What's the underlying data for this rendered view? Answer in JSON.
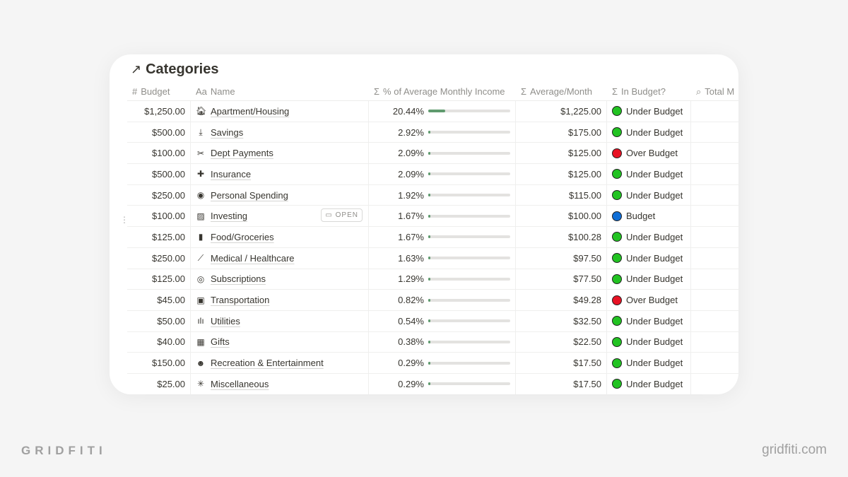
{
  "title": "Categories",
  "columns": [
    {
      "icon": "hash-icon",
      "glyph": "#",
      "label": "Budget"
    },
    {
      "icon": "text-icon",
      "glyph": "Aa",
      "label": "Name"
    },
    {
      "icon": "sigma-icon",
      "glyph": "Σ",
      "label": "% of Average Monthly Income"
    },
    {
      "icon": "sigma-icon",
      "glyph": "Σ",
      "label": "Average/Month"
    },
    {
      "icon": "sigma-icon",
      "glyph": "Σ",
      "label": "In Budget?"
    },
    {
      "icon": "search-icon",
      "glyph": "⌕",
      "label": "Total M"
    }
  ],
  "open_label": "OPEN",
  "status_colors": {
    "Under Budget": "#22c322",
    "Over Budget": "#e81224",
    "Budget": "#0f6ed6"
  },
  "rows": [
    {
      "budget": "$1,250.00",
      "icon": "house-icon",
      "glyph": "🏠︎",
      "name": "Apartment/Housing",
      "pct": "20.44%",
      "pct_value": 20.44,
      "avg": "$1,225.00",
      "status": "Under Budget"
    },
    {
      "budget": "$500.00",
      "icon": "download-icon",
      "glyph": "⤓",
      "name": "Savings",
      "pct": "2.92%",
      "pct_value": 2.92,
      "avg": "$175.00",
      "status": "Under Budget"
    },
    {
      "budget": "$100.00",
      "icon": "debt-icon",
      "glyph": "✂",
      "name": "Dept Payments",
      "pct": "2.09%",
      "pct_value": 2.09,
      "avg": "$125.00",
      "status": "Over Budget"
    },
    {
      "budget": "$500.00",
      "icon": "cross-icon",
      "glyph": "✚",
      "name": "Insurance",
      "pct": "2.09%",
      "pct_value": 2.09,
      "avg": "$125.00",
      "status": "Under Budget"
    },
    {
      "budget": "$250.00",
      "icon": "user-circle-icon",
      "glyph": "◉",
      "name": "Personal Spending",
      "pct": "1.92%",
      "pct_value": 1.92,
      "avg": "$115.00",
      "status": "Under Budget"
    },
    {
      "budget": "$100.00",
      "icon": "chart-icon",
      "glyph": "▨",
      "name": "Investing",
      "pct": "1.67%",
      "pct_value": 1.67,
      "avg": "$100.00",
      "status": "Budget",
      "open": true
    },
    {
      "budget": "$125.00",
      "icon": "bread-icon",
      "glyph": "▮",
      "name": "Food/Groceries",
      "pct": "1.67%",
      "pct_value": 1.67,
      "avg": "$100.28",
      "status": "Under Budget"
    },
    {
      "budget": "$250.00",
      "icon": "syringe-icon",
      "glyph": "⟋",
      "name": "Medical / Healthcare",
      "pct": "1.63%",
      "pct_value": 1.63,
      "avg": "$97.50",
      "status": "Under Budget"
    },
    {
      "budget": "$125.00",
      "icon": "target-icon",
      "glyph": "◎",
      "name": "Subscriptions",
      "pct": "1.29%",
      "pct_value": 1.29,
      "avg": "$77.50",
      "status": "Under Budget"
    },
    {
      "budget": "$45.00",
      "icon": "train-icon",
      "glyph": "▣",
      "name": "Transportation",
      "pct": "0.82%",
      "pct_value": 0.82,
      "avg": "$49.28",
      "status": "Over Budget"
    },
    {
      "budget": "$50.00",
      "icon": "utilities-icon",
      "glyph": "ılı",
      "name": "Utilities",
      "pct": "0.54%",
      "pct_value": 0.54,
      "avg": "$32.50",
      "status": "Under Budget"
    },
    {
      "budget": "$40.00",
      "icon": "gift-icon",
      "glyph": "▦",
      "name": "Gifts",
      "pct": "0.38%",
      "pct_value": 0.38,
      "avg": "$22.50",
      "status": "Under Budget"
    },
    {
      "budget": "$150.00",
      "icon": "masks-icon",
      "glyph": "☻",
      "name": "Recreation & Entertainment",
      "pct": "0.29%",
      "pct_value": 0.29,
      "avg": "$17.50",
      "status": "Under Budget"
    },
    {
      "budget": "$25.00",
      "icon": "asterisk-icon",
      "glyph": "✳",
      "name": "Miscellaneous",
      "pct": "0.29%",
      "pct_value": 0.29,
      "avg": "$17.50",
      "status": "Under Budget"
    }
  ],
  "brand_left": "GRIDFITI",
  "brand_right": "gridfiti.com"
}
